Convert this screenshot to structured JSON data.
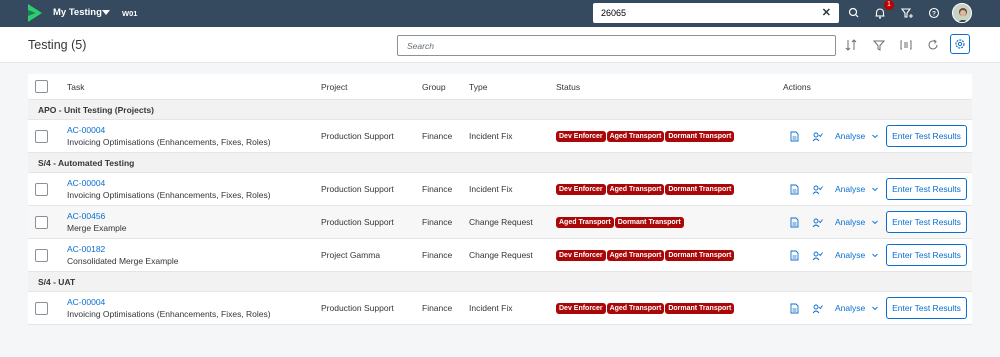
{
  "shell": {
    "app_title": "My Testing",
    "app_subtitle": "W01",
    "search_value": "26065",
    "notification_count": "1"
  },
  "page": {
    "title": "Testing (5)",
    "search_placeholder": "Search"
  },
  "table": {
    "columns": {
      "task": "Task",
      "project": "Project",
      "group": "Group",
      "type": "Type",
      "status": "Status",
      "actions": "Actions"
    },
    "action_labels": {
      "analyse": "Analyse",
      "enter_results": "Enter Test Results"
    },
    "groups": [
      {
        "title": "APO - Unit Testing (Projects)",
        "rows": [
          {
            "id": "AC-00004",
            "name": "Invoicing Optimisations (Enhancements, Fixes, Roles)",
            "project": "Production Support",
            "group": "Finance",
            "type": "Incident Fix",
            "tags": [
              "Dev Enforcer",
              "Aged Transport",
              "Dormant Transport"
            ]
          }
        ]
      },
      {
        "title": "S/4 - Automated Testing",
        "rows": [
          {
            "id": "AC-00004",
            "name": "Invoicing Optimisations (Enhancements, Fixes, Roles)",
            "project": "Production Support",
            "group": "Finance",
            "type": "Incident Fix",
            "tags": [
              "Dev Enforcer",
              "Aged Transport",
              "Dormant Transport"
            ]
          },
          {
            "id": "AC-00456",
            "name": "Merge Example",
            "project": "Production Support",
            "group": "Finance",
            "type": "Change Request",
            "tags": [
              "Aged Transport",
              "Dormant Transport"
            ]
          },
          {
            "id": "AC-00182",
            "name": "Consolidated Merge Example",
            "project": "Project Gamma",
            "group": "Finance",
            "type": "Change Request",
            "tags": [
              "Dev Enforcer",
              "Aged Transport",
              "Dormant Transport"
            ]
          }
        ]
      },
      {
        "title": "S/4 - UAT",
        "rows": [
          {
            "id": "AC-00004",
            "name": "Invoicing Optimisations (Enhancements, Fixes, Roles)",
            "project": "Production Support",
            "group": "Finance",
            "type": "Incident Fix",
            "tags": [
              "Dev Enforcer",
              "Aged Transport",
              "Dormant Transport"
            ]
          }
        ]
      }
    ]
  },
  "colors": {
    "shell_bg": "#354a5f",
    "link": "#0a6ed1",
    "tag_bg": "#aa0808",
    "page_bg": "#f5f6f7"
  },
  "icons": {
    "logo": "app-logo",
    "shell": [
      "search-icon",
      "bell-icon",
      "filter-add-icon",
      "help-icon",
      "avatar"
    ],
    "toolbar": [
      "sort-icon",
      "filter-icon",
      "group-icon",
      "refresh-icon",
      "settings-icon"
    ],
    "row_actions": [
      "document-icon",
      "assign-user-icon",
      "chevron-down-icon"
    ]
  }
}
